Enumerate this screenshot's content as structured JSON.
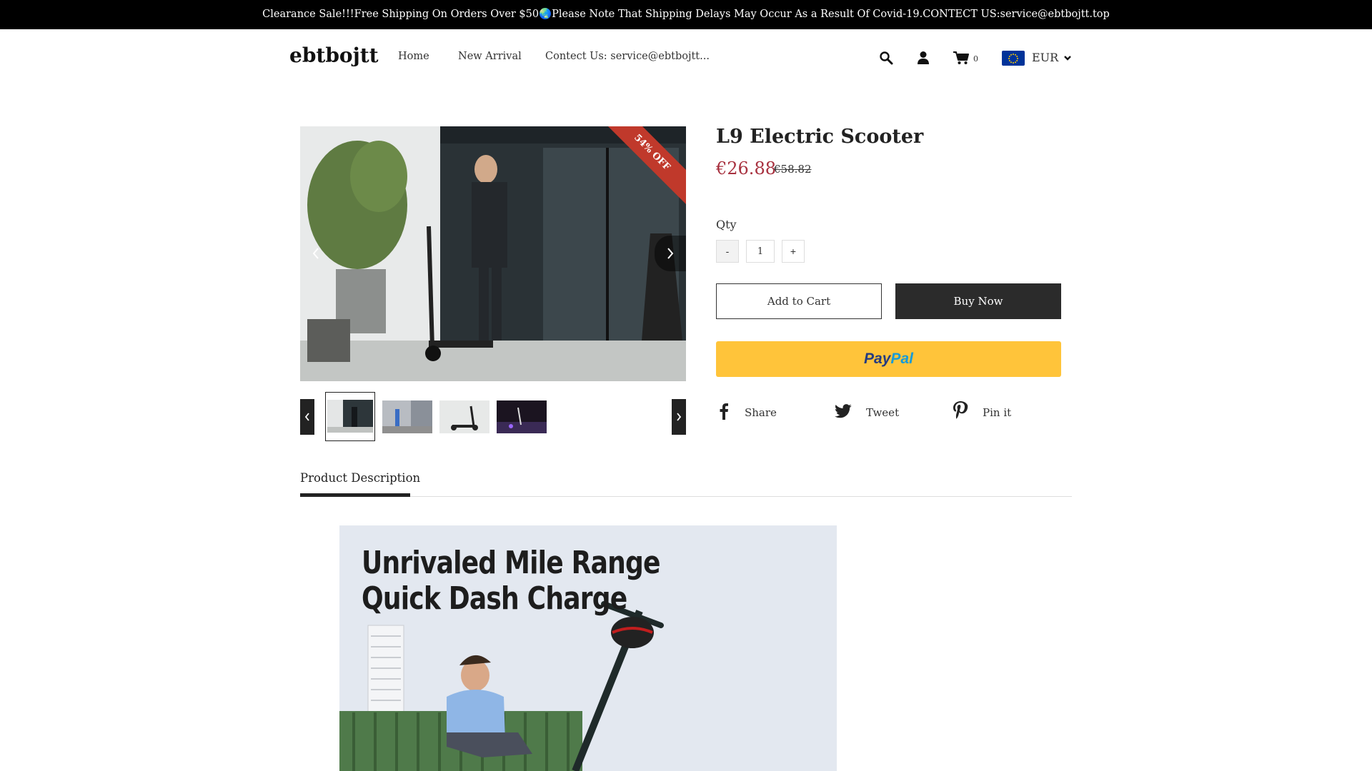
{
  "announcement": "Clearance Sale!!!Free Shipping On Orders Over $50🌏Please Note That Shipping Delays May Occur As a Result Of Covid-19.CONTECT US:service@ebtbojtt.top",
  "header": {
    "logo": "ebtbojtt",
    "nav": [
      "Home",
      "New Arrival",
      "Contect Us: service@ebtbojtt..."
    ],
    "cart_count": "0",
    "currency": "EUR",
    "icons": [
      "search-icon",
      "account-icon",
      "cart-icon",
      "eu-flag-icon",
      "chevron-down-icon"
    ]
  },
  "product": {
    "title": "L9 Electric Scooter",
    "price": "€26.88",
    "compare_price": "€58.82",
    "discount_badge": "54% OFF",
    "qty_label": "Qty",
    "qty_value": "1",
    "minus": "-",
    "plus": "+",
    "add_to_cart": "Add to Cart",
    "buy_now": "Buy Now",
    "paypal_pay": "Pay",
    "paypal_pal": "Pal",
    "share": [
      {
        "icon": "facebook-icon",
        "label": "Share"
      },
      {
        "icon": "twitter-icon",
        "label": "Tweet"
      },
      {
        "icon": "pinterest-icon",
        "label": "Pin it"
      }
    ]
  },
  "description": {
    "tab": "Product Description",
    "headline_line1": "Unrivaled Mile Range",
    "headline_line2": "Quick Dash Charge"
  },
  "colors": {
    "announcement_bg": "#000000",
    "price": "#a83240",
    "badge": "#c0392b",
    "paypal_bg": "#ffc43a",
    "paypal_dark": "#253b80",
    "paypal_light": "#179bd7",
    "buy_now_bg": "#2b2b2b"
  }
}
